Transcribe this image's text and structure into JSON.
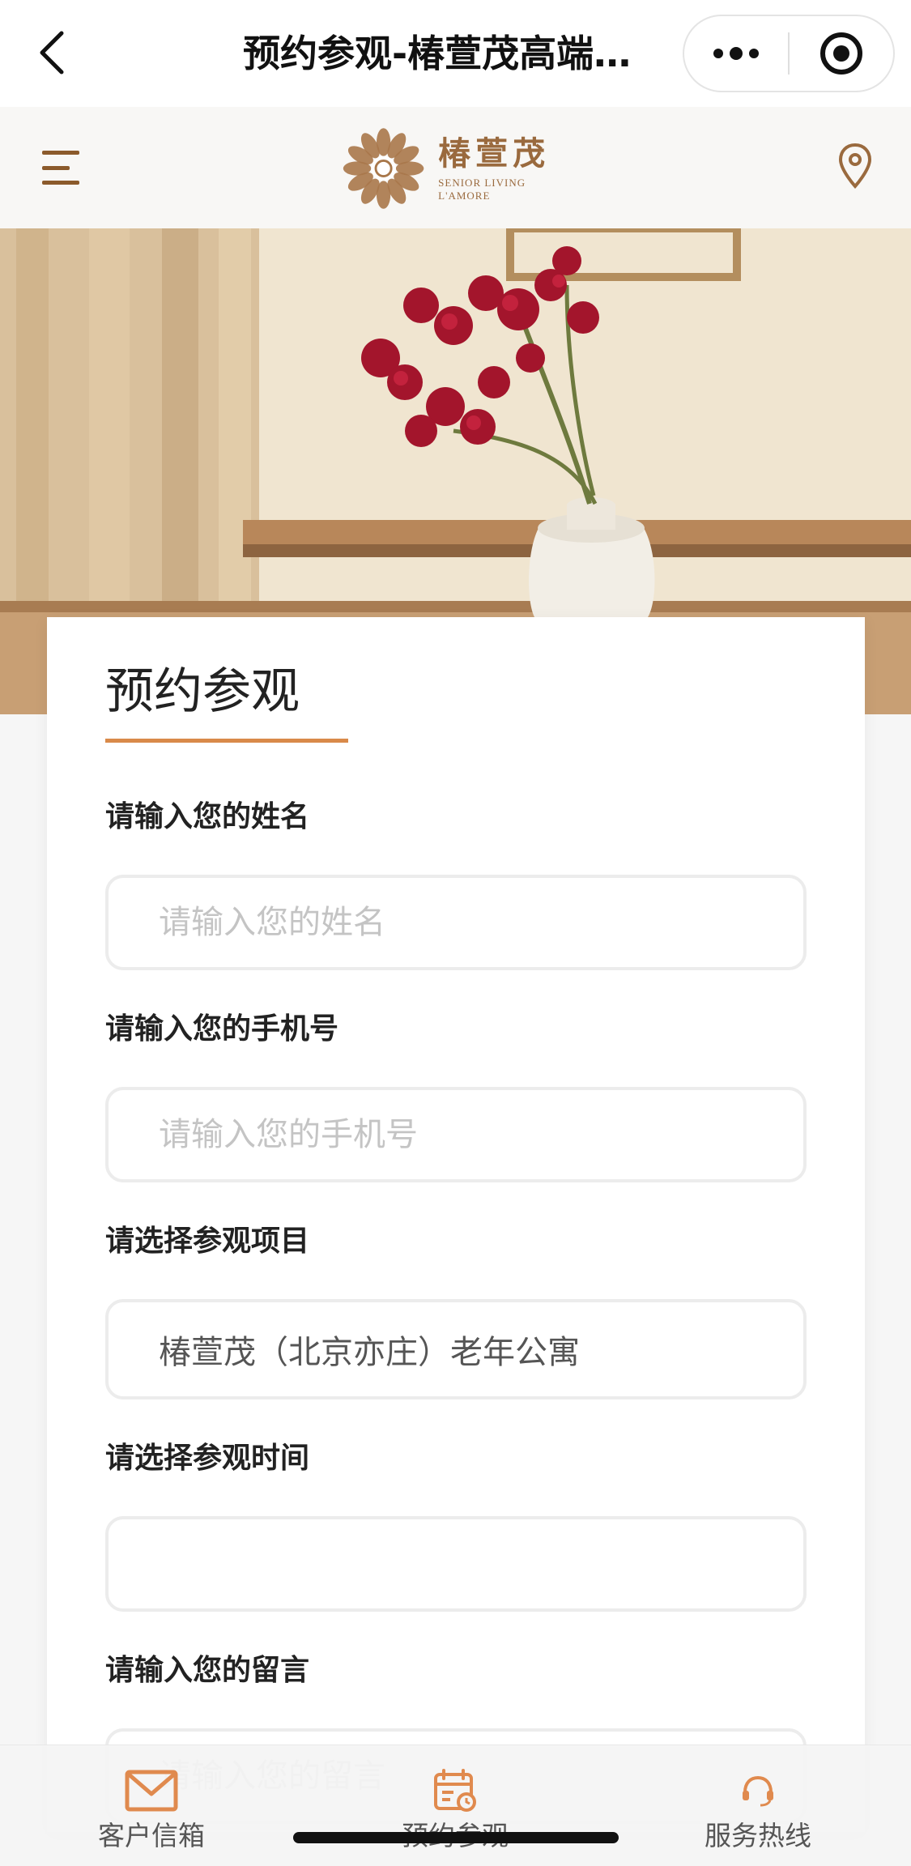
{
  "navbar": {
    "title": "预约参观-椿萱茂高端…",
    "more_icon": "more-dots-icon",
    "close_icon": "target-circle-icon"
  },
  "header": {
    "logo_cn": "椿萱茂",
    "logo_en": "SENIOR LIVING L'AMORE",
    "menu_icon": "menu-icon",
    "location_icon": "location-pin-icon"
  },
  "form": {
    "title": "预约参观",
    "name_label": "请输入您的姓名",
    "name_placeholder": "请输入您的姓名",
    "phone_label": "请输入您的手机号",
    "phone_placeholder": "请输入您的手机号",
    "project_label": "请选择参观项目",
    "project_value": "椿萱茂（北京亦庄）老年公寓",
    "time_label": "请选择参观时间",
    "time_value": "",
    "message_label": "请输入您的留言",
    "message_placeholder": "请输入您的留言"
  },
  "tabbar": {
    "items": [
      {
        "label": "客户信箱",
        "icon": "mail-icon"
      },
      {
        "label": "预约参观",
        "icon": "calendar-icon"
      },
      {
        "label": "服务热线",
        "icon": "headset-icon"
      }
    ]
  },
  "colors": {
    "accent": "#d98a4a",
    "brand": "#9a6a3e"
  }
}
